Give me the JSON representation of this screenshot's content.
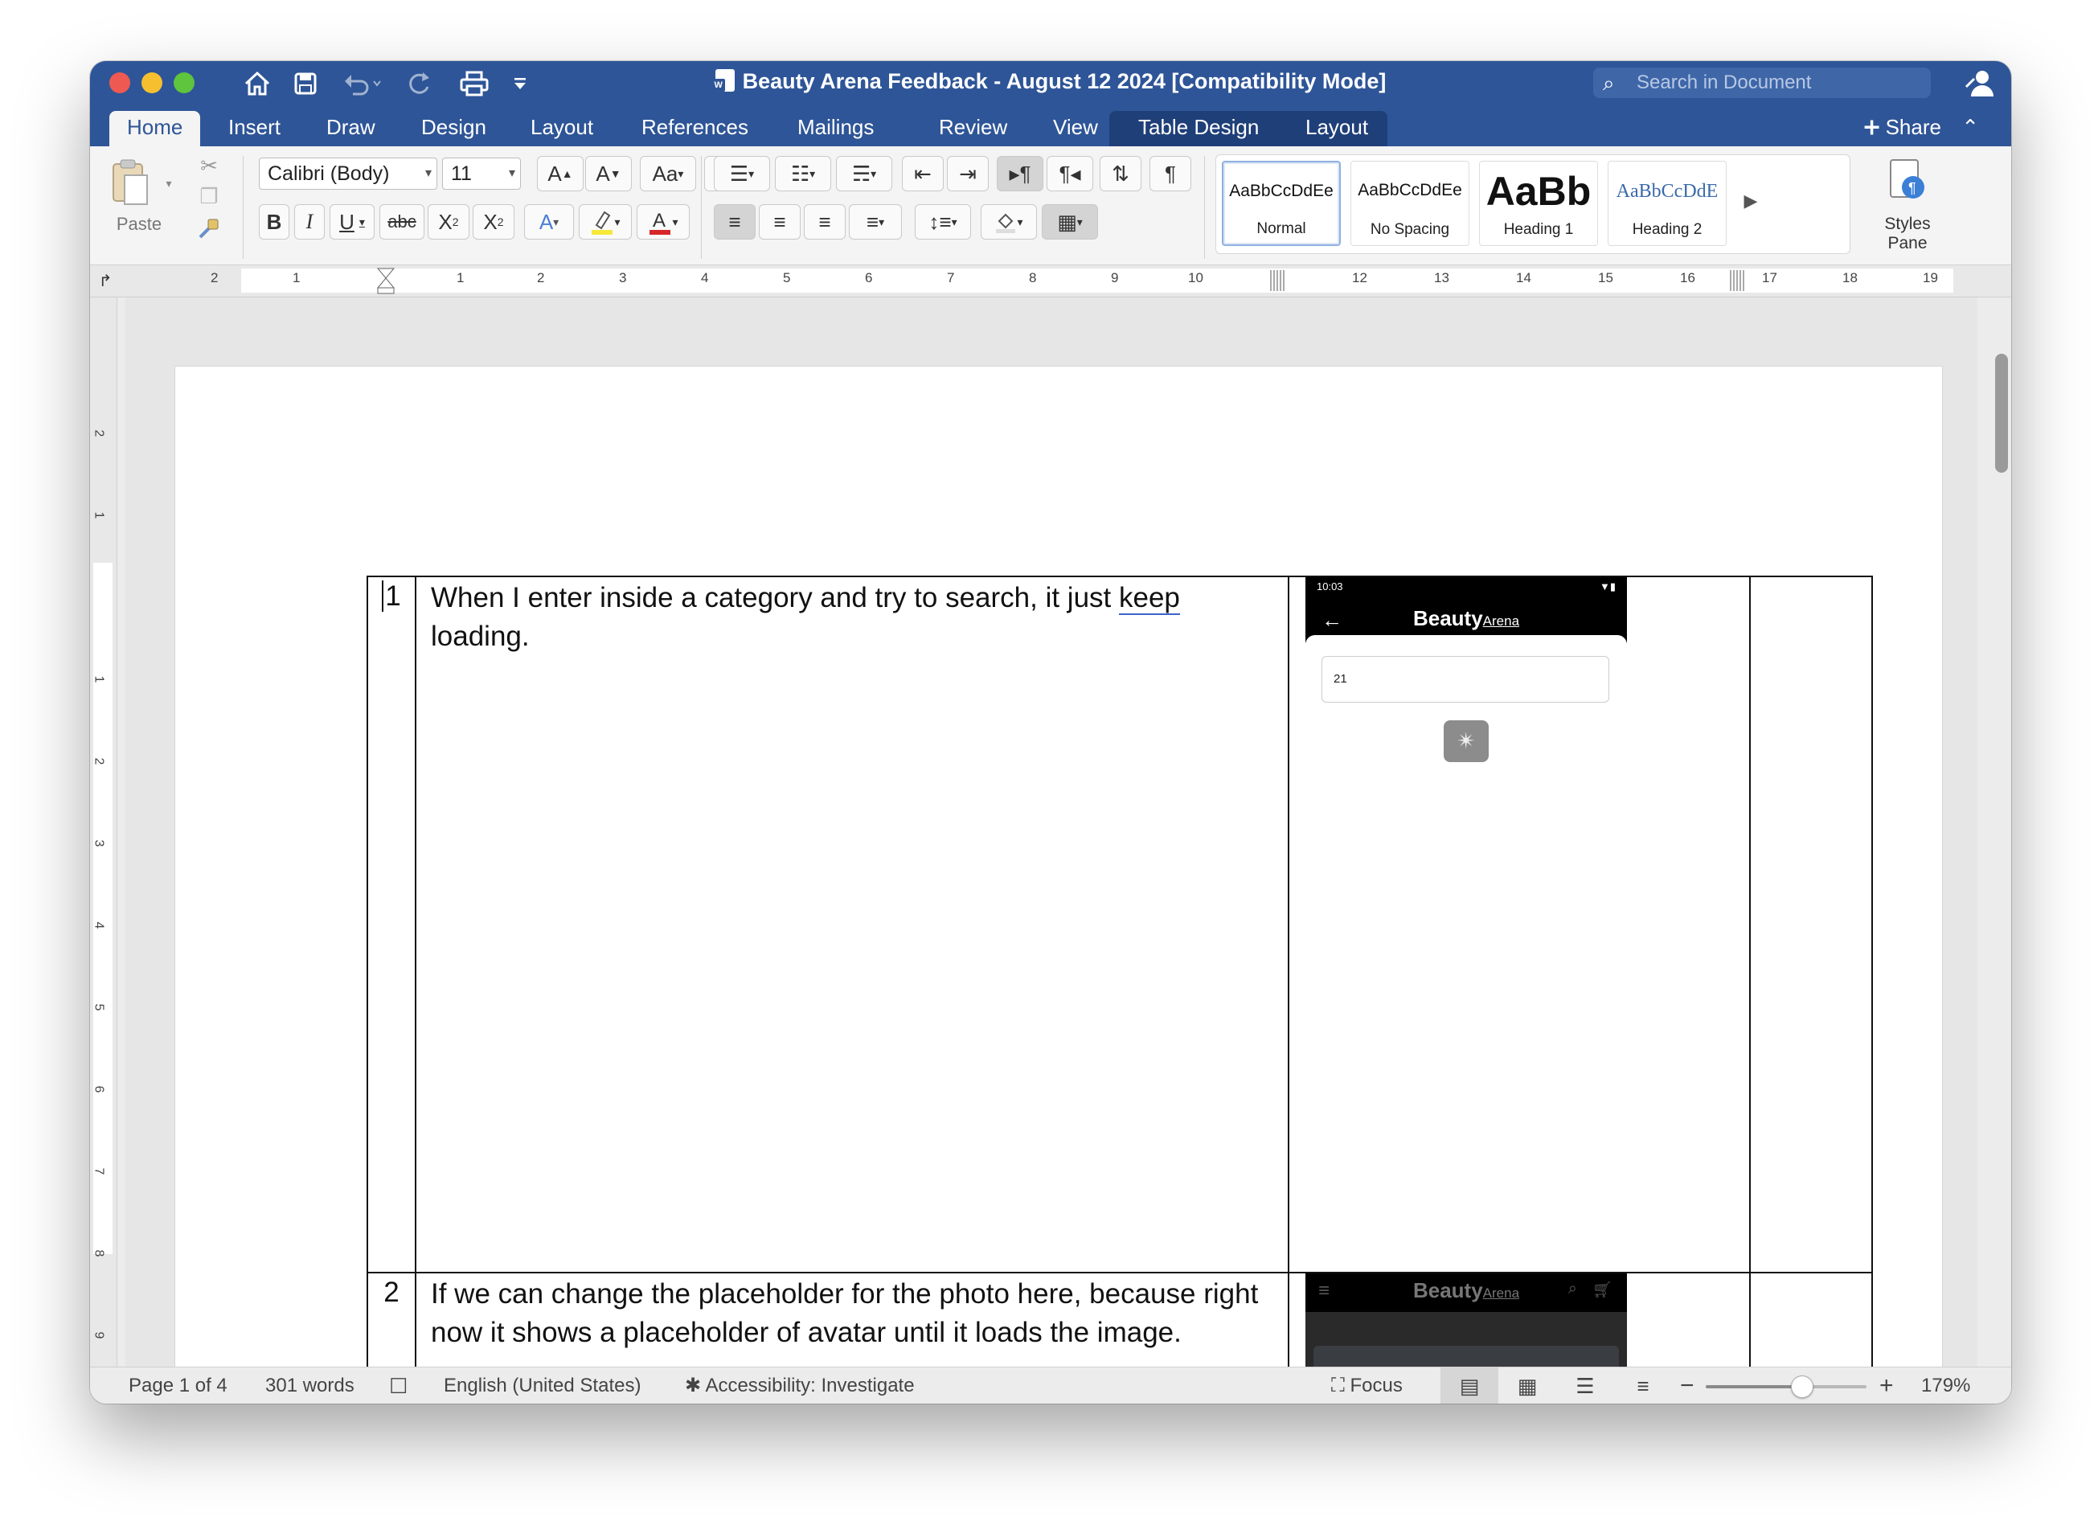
{
  "window": {
    "title": "Beauty Arena Feedback - August 12 2024 [Compatibility Mode]",
    "search_placeholder": "Search in Document"
  },
  "tabs": [
    {
      "label": "Home"
    },
    {
      "label": "Insert"
    },
    {
      "label": "Draw"
    },
    {
      "label": "Design"
    },
    {
      "label": "Layout"
    },
    {
      "label": "References"
    },
    {
      "label": "Mailings"
    },
    {
      "label": "Review"
    },
    {
      "label": "View"
    },
    {
      "label": "Table Design"
    },
    {
      "label": "Layout"
    }
  ],
  "share_label": "Share",
  "ribbon": {
    "paste_label": "Paste",
    "font_name": "Calibri (Body)",
    "font_size": "11",
    "styles": [
      {
        "sample": "AaBbCcDdEe",
        "name": "Normal"
      },
      {
        "sample": "AaBbCcDdEe",
        "name": "No Spacing"
      },
      {
        "sample": "AaBb",
        "name": "Heading 1"
      },
      {
        "sample": "AaBbCcDdE",
        "name": "Heading 2"
      }
    ],
    "styles_pane_label": "Styles Pane"
  },
  "hruler_ticks": [
    "2",
    "1",
    "1",
    "2",
    "3",
    "4",
    "5",
    "6",
    "7",
    "8",
    "9",
    "10",
    "12",
    "13",
    "14",
    "15",
    "16",
    "17",
    "18",
    "19"
  ],
  "vruler_ticks": [
    "2",
    "1",
    "1",
    "2",
    "3",
    "4",
    "5",
    "6",
    "7",
    "8",
    "9",
    "10"
  ],
  "document": {
    "rows": [
      {
        "num": "1",
        "text_before": "When I enter inside a category and try to search, it just ",
        "text_underlined": "keep",
        "text_after": " loading.",
        "phone": {
          "time": "10:03",
          "logo_main": "Beauty",
          "logo_sub": "Arena",
          "search_value": "21"
        }
      },
      {
        "num": "2",
        "text": "If we can change the placeholder for the photo here, because right now it shows a placeholder of avatar until it loads the image.",
        "phone": {
          "logo_main": "Beauty",
          "logo_sub": "Arena"
        }
      }
    ]
  },
  "statusbar": {
    "page": "Page 1 of 4",
    "words": "301 words",
    "language": "English (United States)",
    "accessibility": "Accessibility: Investigate",
    "focus": "Focus",
    "zoom": "179%",
    "zoom_level_fraction": 0.6
  }
}
